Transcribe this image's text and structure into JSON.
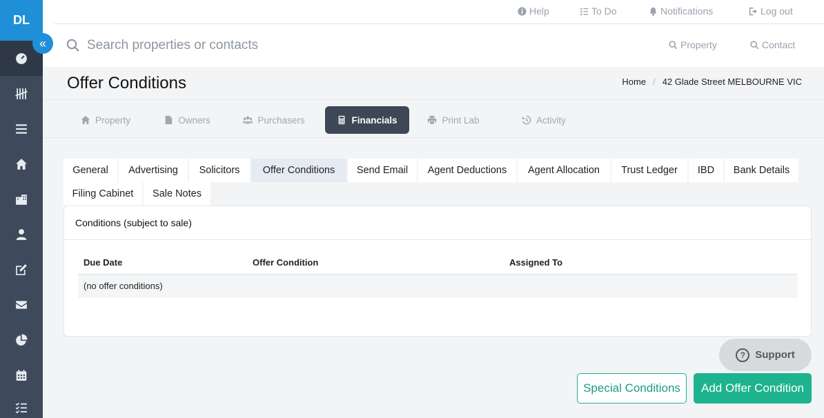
{
  "sidebar": {
    "initials": "DL",
    "items": [
      {
        "icon": "dashboard-icon"
      },
      {
        "icon": "tally-icon"
      },
      {
        "icon": "list-icon"
      },
      {
        "icon": "home-icon"
      },
      {
        "icon": "building-icon"
      },
      {
        "icon": "user-icon"
      },
      {
        "icon": "edit-icon"
      },
      {
        "icon": "mail-icon"
      },
      {
        "icon": "pie-chart-icon"
      },
      {
        "icon": "calendar-icon"
      },
      {
        "icon": "checklist-icon"
      }
    ]
  },
  "topbar": {
    "help": "Help",
    "todo": "To Do",
    "notifications": "Notifications",
    "logout": "Log out"
  },
  "search": {
    "placeholder": "Search properties or contacts",
    "property": "Property",
    "contact": "Contact"
  },
  "page": {
    "title": "Offer Conditions",
    "breadcrumb": [
      "Home",
      "42 Glade Street MELBOURNE VIC"
    ]
  },
  "main_tabs": [
    {
      "label": "Property"
    },
    {
      "label": "Owners"
    },
    {
      "label": "Purchasers"
    },
    {
      "label": "Financials"
    },
    {
      "label": "Print Lab"
    },
    {
      "label": "Activity"
    }
  ],
  "sub_tabs": [
    {
      "label": "General"
    },
    {
      "label": "Advertising"
    },
    {
      "label": "Solicitors"
    },
    {
      "label": "Offer Conditions"
    },
    {
      "label": "Send Email"
    },
    {
      "label": "Agent Deductions"
    },
    {
      "label": "Agent Allocation"
    },
    {
      "label": "Trust Ledger"
    },
    {
      "label": "IBD"
    },
    {
      "label": "Bank Details"
    },
    {
      "label": "Filing Cabinet"
    },
    {
      "label": "Sale Notes"
    }
  ],
  "card": {
    "title": "Conditions (subject to sale)",
    "columns": [
      "Due Date",
      "Offer Condition",
      "Assigned To"
    ],
    "empty": "(no offer conditions)"
  },
  "buttons": {
    "support": "Support",
    "special": "Special Conditions",
    "add": "Add Offer Condition"
  },
  "colors": {
    "sidebar": "#3e4a5b",
    "accent_blue": "#1f8fd8",
    "accent_green": "#1db38e"
  }
}
